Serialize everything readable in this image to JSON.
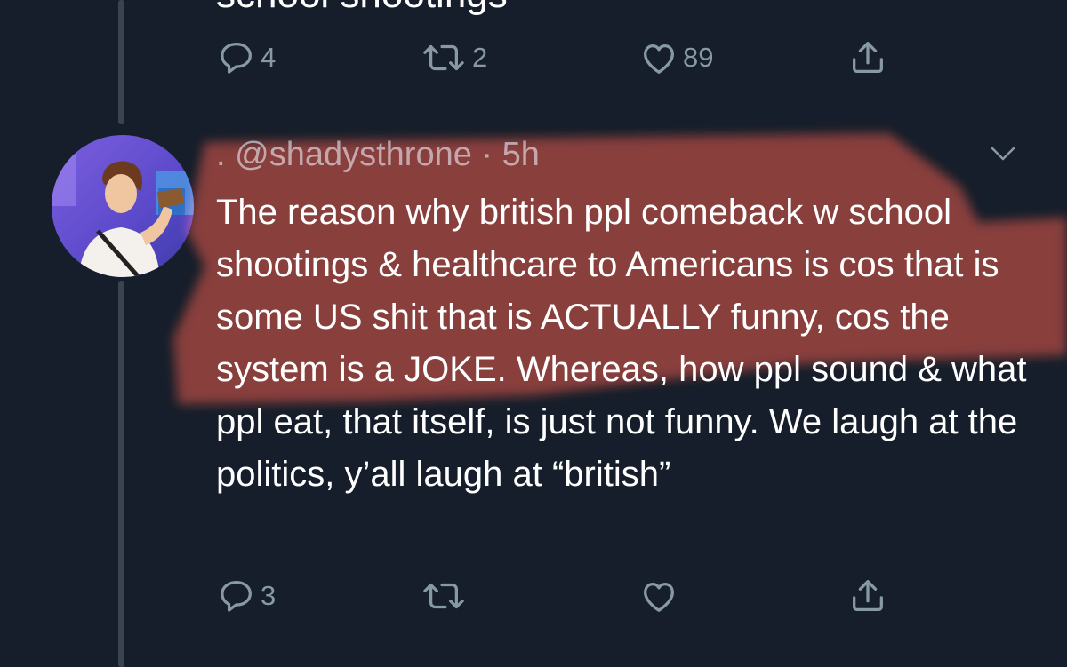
{
  "previous_tweet": {
    "cutoff_text": "school shootings",
    "actions": {
      "reply_count": "4",
      "retweet_count": "2",
      "like_count": "89"
    }
  },
  "tweet": {
    "display_name": ".",
    "handle": "@shadysthrone",
    "separator": "·",
    "time": "5h",
    "text": "The reason why british ppl comeback w school shootings & healthcare to Americans is cos that is some US shit that is ACTUALLY funny, cos the system is a JOKE. Whereas, how ppl sound & what ppl eat, that itself, is just not funny. We laugh at the politics, y’all laugh at “british”",
    "actions": {
      "reply_count": "3",
      "retweet_count": "",
      "like_count": ""
    }
  },
  "icons": {
    "reply": "reply-icon",
    "retweet": "retweet-icon",
    "like": "heart-icon",
    "share": "share-icon",
    "menu": "chevron-down-icon"
  },
  "colors": {
    "background": "#151e2a",
    "text": "#ffffff",
    "secondary_text": "#8899a6",
    "thread_line": "#3a4350",
    "highlight_overlay": "#b83a22"
  }
}
